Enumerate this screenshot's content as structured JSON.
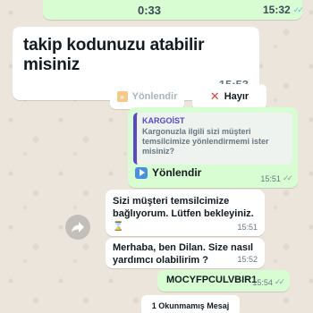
{
  "audio_message": {
    "duration": "0:33",
    "time": "15:32"
  },
  "question_message": {
    "text": "takip kodunuzu atabilir misiniz",
    "time": "15:53"
  },
  "quick_replies": {
    "forward_label": "Yönlendir",
    "cancel_label": "Hayır"
  },
  "reply_message": {
    "quote_sender": "KARGOİST",
    "quote_text": "Kargonuzla ilgili sizi müşteri temsilcimize yönlendirmemi ister misiniz?",
    "body": "Yönlendir",
    "time": "15:51"
  },
  "messages": [
    {
      "text": "Sizi müşteri temsilcimize bağlıyorum. Lütfen bekleyiniz.",
      "emoji": "⌛",
      "time": "15:51"
    },
    {
      "text": "Merhaba, ben Dilan. Size nasıl yardımcı olabilirim ?",
      "time": "15:52"
    },
    {
      "text": "MOCYFPCULVBIR1",
      "time": "15:54"
    }
  ],
  "unread_banner": "1 Okunmamış Mesaj",
  "colors": {
    "outgoing_bubble": "#d9fdd3",
    "read_ticks": "#53bdeb",
    "quote_accent": "#5a48c4"
  }
}
